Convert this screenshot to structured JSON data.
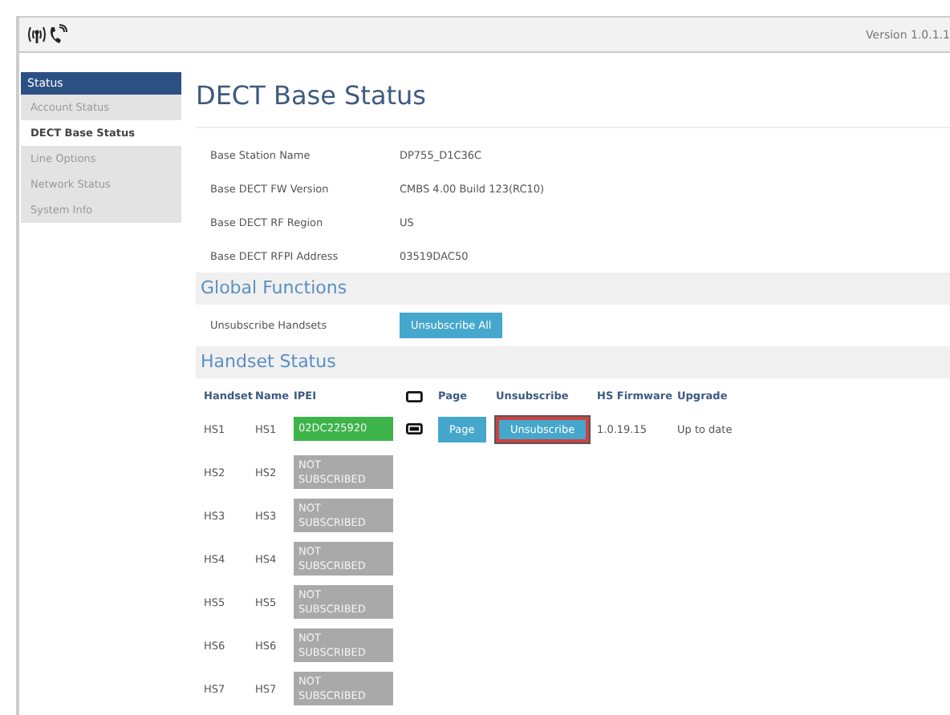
{
  "header": {
    "version": "Version 1.0.1.1"
  },
  "sidebar": {
    "section": "Status",
    "items": [
      {
        "label": "Account Status",
        "selected": false
      },
      {
        "label": "DECT Base Status",
        "selected": true
      },
      {
        "label": "Line Options",
        "selected": false
      },
      {
        "label": "Network Status",
        "selected": false
      },
      {
        "label": "System Info",
        "selected": false
      }
    ]
  },
  "page_title": "DECT Base Status",
  "info": [
    {
      "label": "Base Station Name",
      "value": "DP755_D1C36C"
    },
    {
      "label": "Base DECT FW Version",
      "value": "CMBS 4.00 Build 123(RC10)"
    },
    {
      "label": "Base DECT RF Region",
      "value": "US"
    },
    {
      "label": "Base DECT RFPI Address",
      "value": "03519DAC50"
    }
  ],
  "global_functions": {
    "title": "Global Functions",
    "label": "Unsubscribe Handsets",
    "button": "Unsubscribe All"
  },
  "handset_status": {
    "title": "Handset Status",
    "columns": [
      "Handset",
      "Name",
      "IPEI",
      "Page",
      "Unsubscribe",
      "HS Firmware",
      "Upgrade"
    ],
    "rows": [
      {
        "handset": "HS1",
        "name": "HS1",
        "ipei": "02DC225920",
        "subscribed": true,
        "page": "Page",
        "unsubscribe": "Unsubscribe",
        "highlighted": true,
        "firmware": "1.0.19.15",
        "upgrade": "Up to date"
      },
      {
        "handset": "HS2",
        "name": "HS2",
        "ipei": "NOT SUBSCRIBED",
        "subscribed": false
      },
      {
        "handset": "HS3",
        "name": "HS3",
        "ipei": "NOT SUBSCRIBED",
        "subscribed": false
      },
      {
        "handset": "HS4",
        "name": "HS4",
        "ipei": "NOT SUBSCRIBED",
        "subscribed": false
      },
      {
        "handset": "HS5",
        "name": "HS5",
        "ipei": "NOT SUBSCRIBED",
        "subscribed": false
      },
      {
        "handset": "HS6",
        "name": "HS6",
        "ipei": "NOT SUBSCRIBED",
        "subscribed": false
      },
      {
        "handset": "HS7",
        "name": "HS7",
        "ipei": "NOT SUBSCRIBED",
        "subscribed": false
      }
    ]
  }
}
